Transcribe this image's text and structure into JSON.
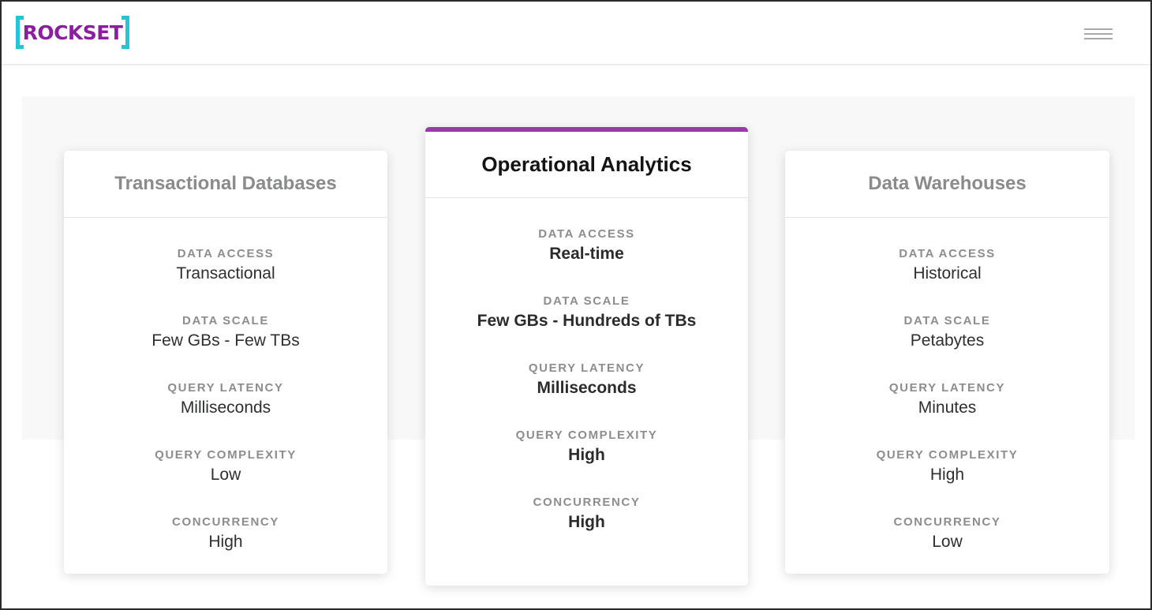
{
  "brand": {
    "logo_text": "ROCKSET"
  },
  "header": {
    "menu_icon": "hamburger-menu-icon"
  },
  "colors": {
    "accent": "#9a3aa8",
    "logo_purple": "#8a1fa0",
    "logo_cyan": "#25c3d4"
  },
  "cards": [
    {
      "title": "Transactional Databases",
      "metrics": [
        {
          "label": "DATA ACCESS",
          "value": "Transactional"
        },
        {
          "label": "DATA SCALE",
          "value": "Few GBs - Few TBs"
        },
        {
          "label": "QUERY LATENCY",
          "value": "Milliseconds"
        },
        {
          "label": "QUERY COMPLEXITY",
          "value": "Low"
        },
        {
          "label": "CONCURRENCY",
          "value": "High"
        }
      ]
    },
    {
      "title": "Operational Analytics",
      "metrics": [
        {
          "label": "DATA ACCESS",
          "value": "Real-time"
        },
        {
          "label": "DATA SCALE",
          "value": "Few GBs - Hundreds of TBs"
        },
        {
          "label": "QUERY LATENCY",
          "value": "Milliseconds"
        },
        {
          "label": "QUERY COMPLEXITY",
          "value": "High"
        },
        {
          "label": "CONCURRENCY",
          "value": "High"
        }
      ]
    },
    {
      "title": "Data Warehouses",
      "metrics": [
        {
          "label": "DATA ACCESS",
          "value": "Historical"
        },
        {
          "label": "DATA SCALE",
          "value": "Petabytes"
        },
        {
          "label": "QUERY LATENCY",
          "value": "Minutes"
        },
        {
          "label": "QUERY COMPLEXITY",
          "value": "High"
        },
        {
          "label": "CONCURRENCY",
          "value": "Low"
        }
      ]
    }
  ]
}
